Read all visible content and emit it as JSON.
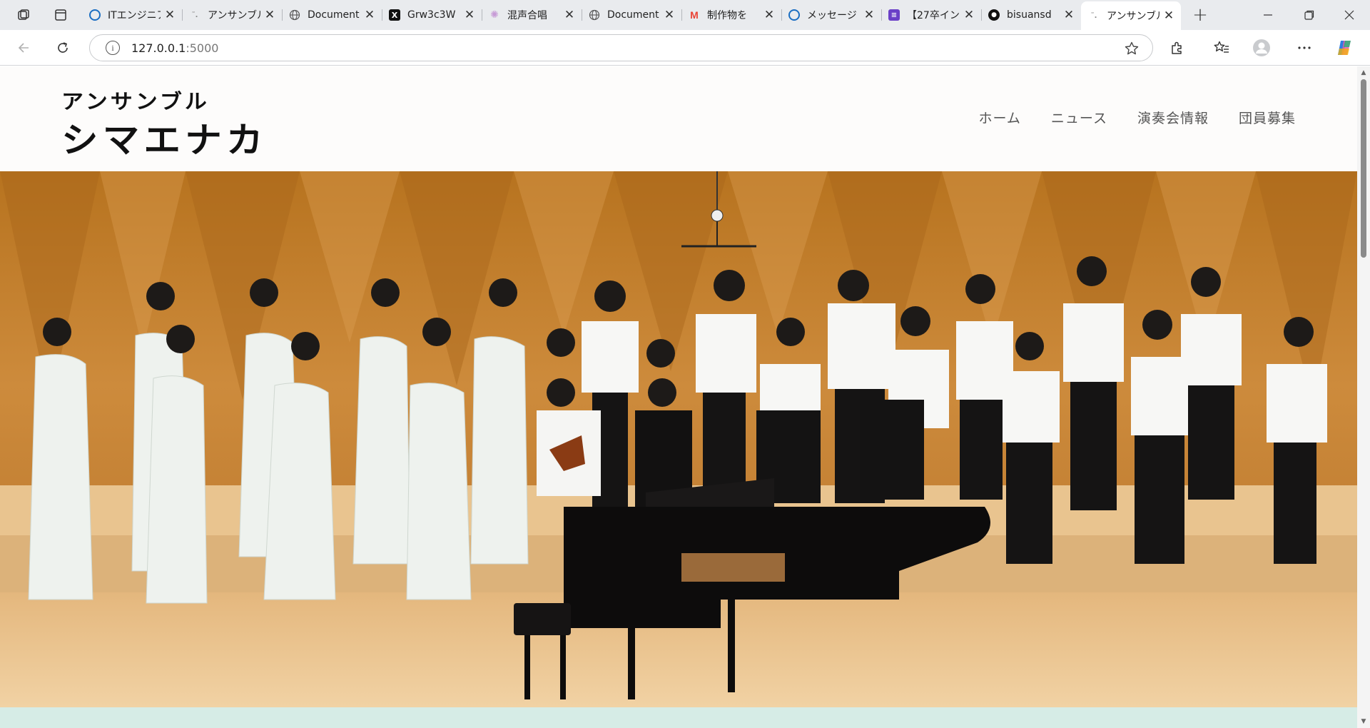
{
  "browser": {
    "tabs": [
      {
        "title": "ITエンジニア",
        "favicon": "copilot-icon",
        "favicon_color": "#1b6ec2"
      },
      {
        "title": "アンサンブル",
        "favicon": "ensemble-icon",
        "favicon_color": "#888888"
      },
      {
        "title": "Document",
        "favicon": "globe-icon",
        "favicon_color": "#555555"
      },
      {
        "title": "Grw3c3W",
        "favicon": "x-logo-icon",
        "favicon_color": "#000000"
      },
      {
        "title": "混声合唱",
        "favicon": "sparkle-icon",
        "favicon_color": "#c79bd6"
      },
      {
        "title": "Document",
        "favicon": "globe-icon",
        "favicon_color": "#555555"
      },
      {
        "title": "制作物を",
        "favicon": "gmail-icon",
        "favicon_color": "#ea4335"
      },
      {
        "title": "メッセージ",
        "favicon": "copilot-icon",
        "favicon_color": "#1b6ec2"
      },
      {
        "title": "【27卒イン",
        "favicon": "list-icon",
        "favicon_color": "#6a3fc7"
      },
      {
        "title": "bisuansd",
        "favicon": "github-icon",
        "favicon_color": "#111111"
      },
      {
        "title": "アンサンブル",
        "favicon": "ensemble-icon",
        "favicon_color": "#888888",
        "active": true
      }
    ],
    "address": {
      "host": "127.0.0.1",
      "port": ":5000"
    }
  },
  "site": {
    "logo_small": "アンサンブル",
    "logo_large": "シマエナカ",
    "nav": [
      {
        "label": "ホーム"
      },
      {
        "label": "ニュース"
      },
      {
        "label": "演奏会情報"
      },
      {
        "label": "団員募集"
      }
    ],
    "hero_description": "choir-group-photo-on-stage-with-grand-piano"
  },
  "colors": {
    "accent_band": "#d6ece6",
    "header_bg": "#fdfcfb",
    "stage_wall": "#c8842f",
    "stage_floor": "#e6b97d"
  }
}
